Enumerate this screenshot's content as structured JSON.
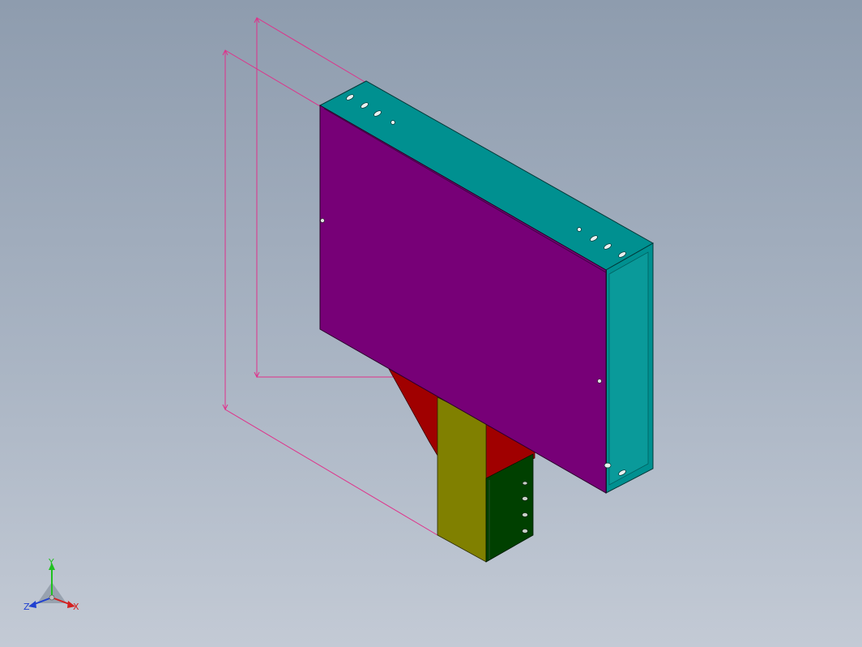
{
  "view": {
    "background_top": "#8e9cae",
    "background_bottom": "#c3cad5"
  },
  "colors": {
    "front_panel": "#770077",
    "top_face": "#009090",
    "side_face": "#009090",
    "support_bracket": "#a00000",
    "post_front": "#808000",
    "post_side": "#004000",
    "dimension_lines": "#e0308a"
  },
  "dimensions": {
    "outer": {
      "label": ""
    },
    "inner": {
      "label": ""
    }
  },
  "triad": {
    "x_label": "X",
    "y_label": "Y",
    "z_label": "Z",
    "x_color": "#d42020",
    "y_color": "#20c020",
    "z_color": "#2040d0"
  }
}
